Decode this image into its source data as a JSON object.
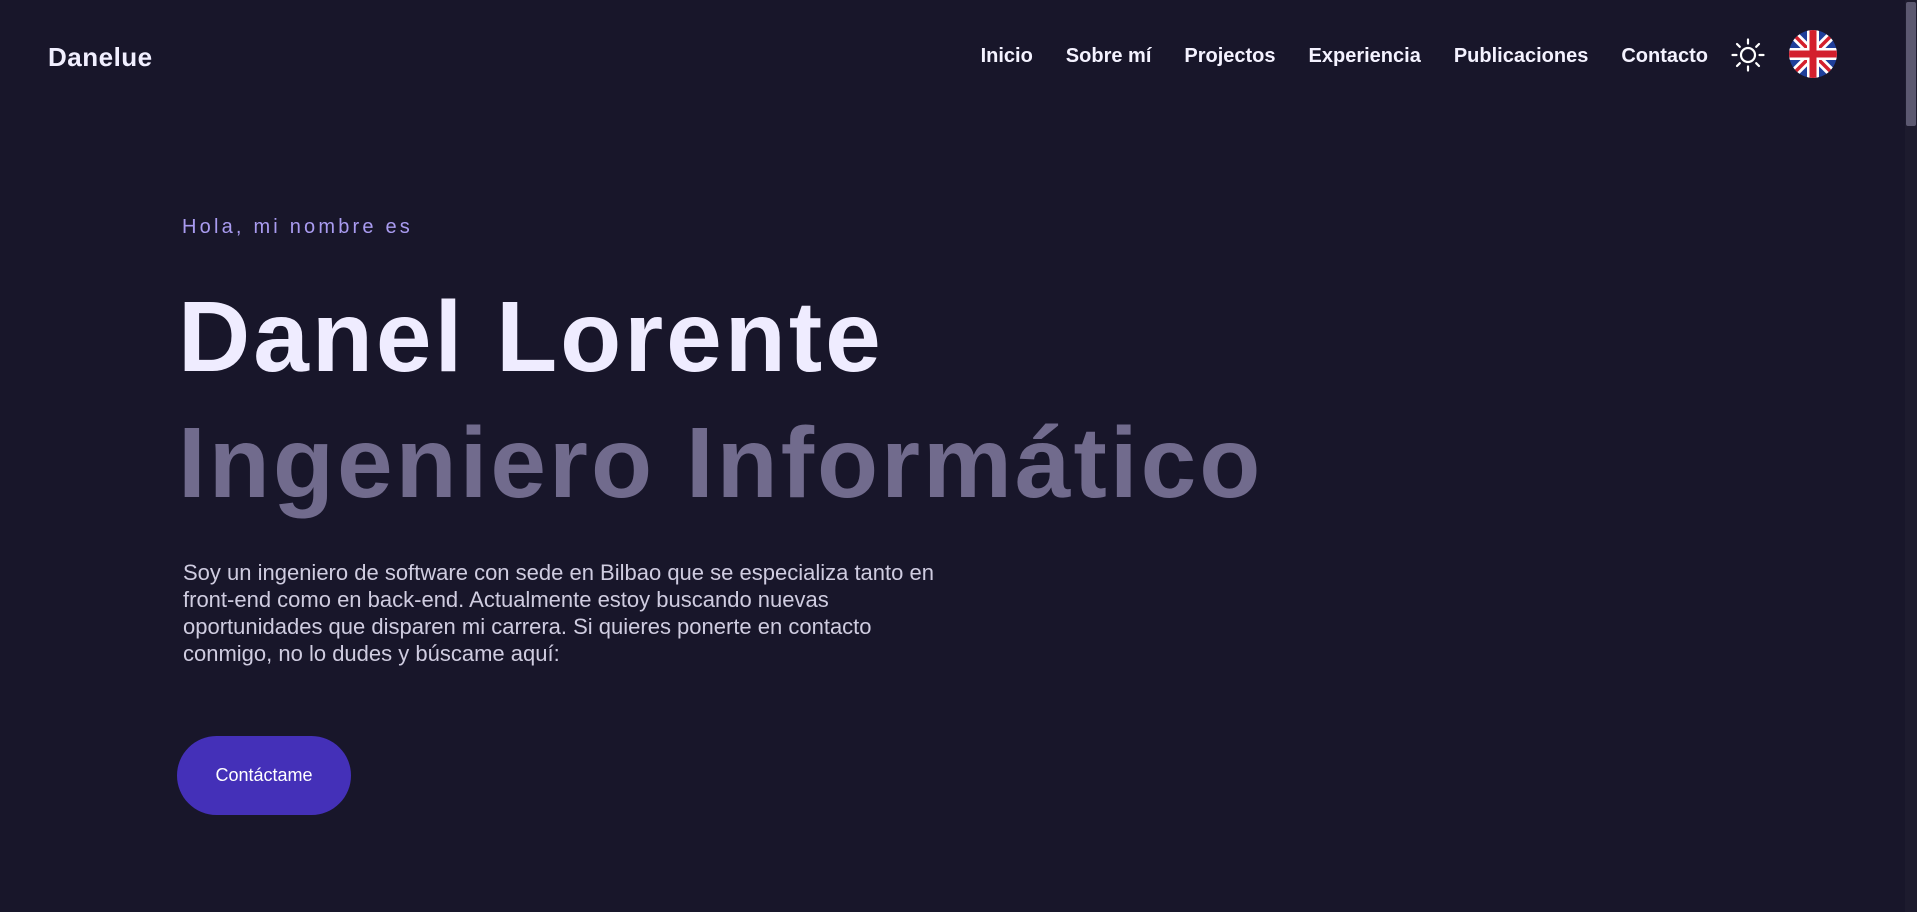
{
  "header": {
    "logo": "Danelue",
    "nav": [
      {
        "label": "Inicio"
      },
      {
        "label": "Sobre mí"
      },
      {
        "label": "Projectos"
      },
      {
        "label": "Experiencia"
      },
      {
        "label": "Publicaciones"
      },
      {
        "label": "Contacto"
      }
    ],
    "theme_icon": "sun-icon",
    "language_icon": "uk-flag-icon"
  },
  "hero": {
    "greeting": "Hola, mi nombre es",
    "name": "Danel Lorente",
    "role": "Ingeniero Informático",
    "description": "Soy un ingeniero de software con sede en Bilbao que se especializa tanto en front-end como en back-end. Actualmente estoy buscando nuevas oportunidades que disparen mi carrera. Si quieres ponerte en contacto conmigo, no lo dudes y búscame aquí:",
    "cta_label": "Contáctame"
  },
  "colors": {
    "background": "#18162a",
    "accent": "#4430b8",
    "greeting": "#a99bf0",
    "role": "#716b8d"
  }
}
